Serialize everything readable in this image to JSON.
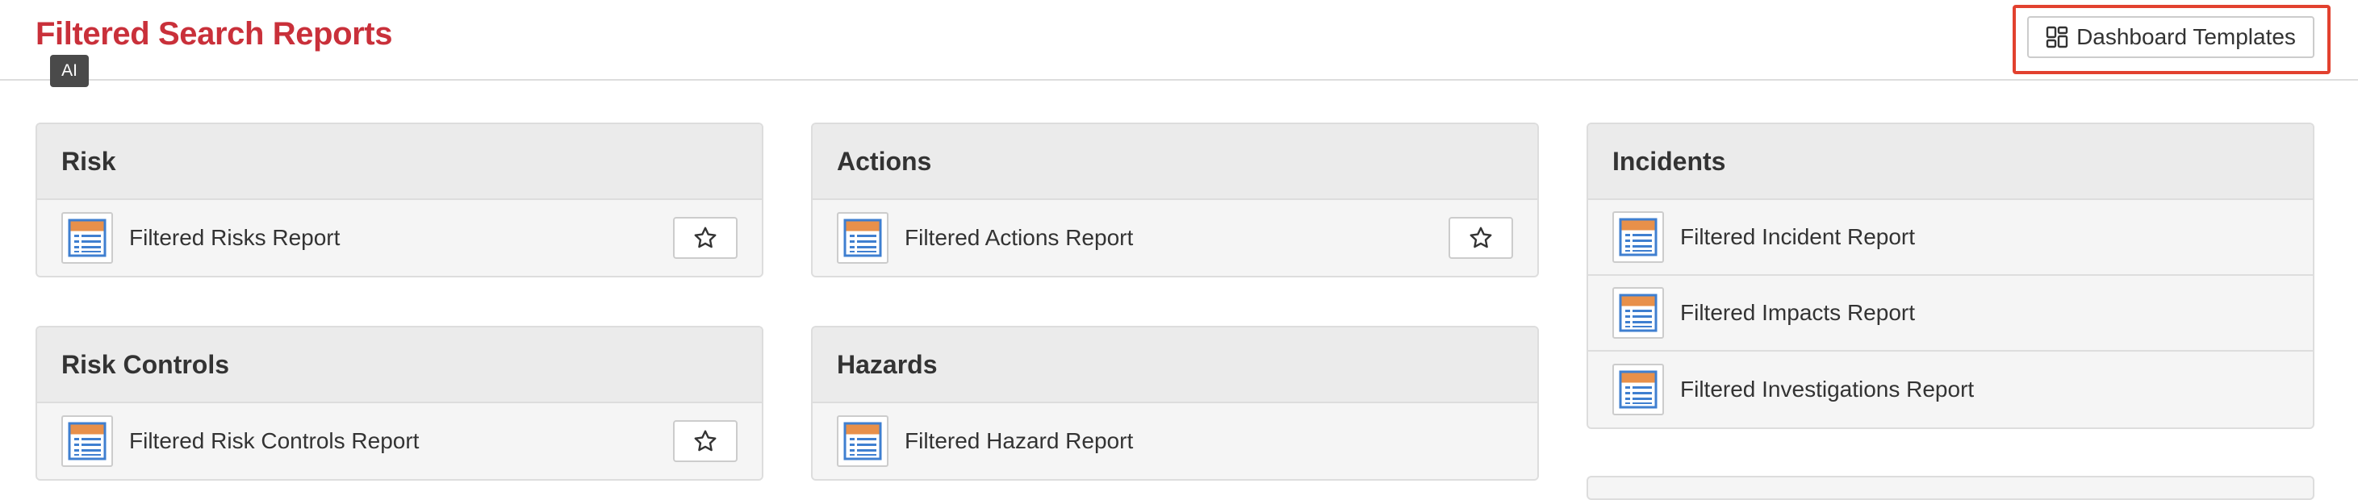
{
  "page": {
    "title": "Filtered Search Reports",
    "ai_badge": "AI",
    "dashboard_button_label": "Dashboard Templates"
  },
  "colors": {
    "title_red": "#c9303a",
    "highlight_red": "#e2412f",
    "icon_orange": "#e8904a",
    "icon_blue": "#3f7fd0"
  },
  "panels": {
    "risk": {
      "title": "Risk",
      "items": [
        {
          "label": "Filtered Risks Report",
          "icon": "report-table-icon",
          "favourite": true
        }
      ]
    },
    "actions": {
      "title": "Actions",
      "items": [
        {
          "label": "Filtered Actions Report",
          "icon": "report-table-icon",
          "favourite": true
        }
      ]
    },
    "incidents": {
      "title": "Incidents",
      "items": [
        {
          "label": "Filtered Incident Report",
          "icon": "report-table-icon",
          "favourite": false
        },
        {
          "label": "Filtered Impacts Report",
          "icon": "report-table-icon",
          "favourite": false
        },
        {
          "label": "Filtered Investigations Report",
          "icon": "report-table-icon",
          "favourite": false
        }
      ]
    },
    "risk_controls": {
      "title": "Risk Controls",
      "items": [
        {
          "label": "Filtered Risk Controls Report",
          "icon": "report-table-icon",
          "favourite": true
        }
      ]
    },
    "hazards": {
      "title": "Hazards",
      "items": [
        {
          "label": "Filtered Hazard Report",
          "icon": "report-table-icon",
          "favourite": false
        }
      ]
    }
  }
}
